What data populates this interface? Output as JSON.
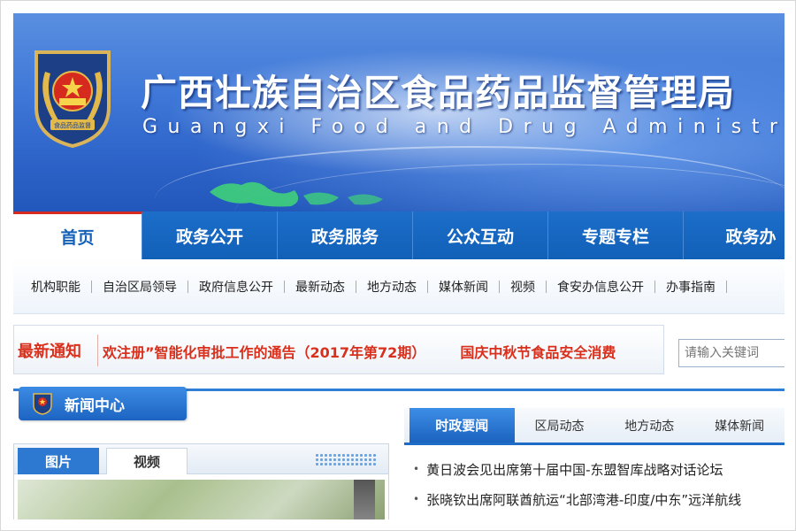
{
  "header": {
    "title": "广西壮族自治区食品药品监督管理局",
    "subtitle": "Guangxi Food and Drug Administration",
    "emblem_text": "食品药品监督"
  },
  "nav": {
    "items": [
      {
        "label": "首页",
        "active": true
      },
      {
        "label": "政务公开"
      },
      {
        "label": "政务服务"
      },
      {
        "label": "公众互动"
      },
      {
        "label": "专题专栏"
      },
      {
        "label": "政务办"
      }
    ]
  },
  "subnav": {
    "items": [
      "机构职能",
      "自治区局领导",
      "政府信息公开",
      "最新动态",
      "地方动态",
      "媒体新闻",
      "视频",
      "食安办信息公开",
      "办事指南"
    ]
  },
  "notice": {
    "label": "最新通知",
    "items": [
      "欢注册”智能化审批工作的通告（2017年第72期）",
      "国庆中秋节食品安全消费"
    ]
  },
  "search": {
    "placeholder": "请输入关键词"
  },
  "news_center": {
    "label": "新闻中心"
  },
  "media_tabs": [
    "图片",
    "视频"
  ],
  "news_tabs": [
    "时政要闻",
    "区局动态",
    "地方动态",
    "媒体新闻"
  ],
  "news_items": [
    "黄日波会见出席第十届中国-东盟智库战略对话论坛",
    "张晓钦出席阿联酋航运“北部湾港-印度/中东”远洋航线"
  ],
  "colors": {
    "brand_blue": "#1461b7",
    "accent_red": "#d8301c"
  }
}
